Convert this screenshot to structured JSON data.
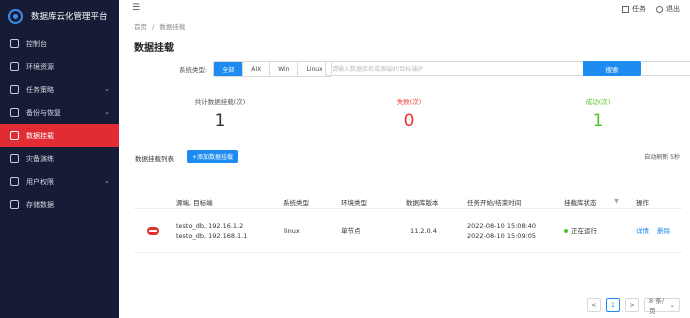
{
  "app": {
    "title": "数据库云化管理平台"
  },
  "sidebar": {
    "items": [
      {
        "label": "控制台",
        "icon": "dashboard-icon"
      },
      {
        "label": "环境资源",
        "icon": "server-icon"
      },
      {
        "label": "任务策略",
        "icon": "task-icon",
        "expand": "⌄"
      },
      {
        "label": "备份与恢复",
        "icon": "backup-icon",
        "expand": "⌄"
      },
      {
        "label": "数据挂载",
        "icon": "mount-icon",
        "active": true
      },
      {
        "label": "灾备演练",
        "icon": "drill-icon"
      },
      {
        "label": "用户权限",
        "icon": "user-icon",
        "expand": "⌄"
      },
      {
        "label": "存储数据",
        "icon": "storage-icon"
      }
    ]
  },
  "header": {
    "menu_glyph": "☰",
    "task_label": "任务",
    "logout_label": "退出"
  },
  "breadcrumb": {
    "home": "首页",
    "sep": "/",
    "current": "数据挂载"
  },
  "page": {
    "title": "数据挂载"
  },
  "filter": {
    "label": "系统类型:",
    "options": [
      "全部",
      "AIX",
      "Win",
      "Linux"
    ],
    "selected": "全部",
    "search_placeholder": "请输入数据库名或源端IP/目标端IP",
    "search_button": "搜索"
  },
  "stats": {
    "total": {
      "label": "共计数据挂载(次)",
      "value": "1"
    },
    "fail": {
      "label": "失败(次)",
      "value": "0"
    },
    "success": {
      "label": "成功(次)",
      "value": "1"
    }
  },
  "section": {
    "title": "数据挂载列表",
    "add_button": "+添加数据挂载",
    "refresh_label": "自动刷新 5秒"
  },
  "table": {
    "headers": [
      "源端, 目标端",
      "系统类型",
      "环境类型",
      "数据库版本",
      "任务开始/结束时间",
      "挂载库状态",
      "操作"
    ],
    "rows": [
      {
        "src": "testo_db, 192.16.1.2",
        "dst": "testo_db, 192.168.1.1",
        "os": "linux",
        "env": "单节点",
        "version": "11.2.0.4",
        "start": "2022-08-10 15:08:40",
        "end": "2022-08-10 15:09:05",
        "status": "正在运行",
        "actions": [
          "详情",
          "删除"
        ]
      }
    ]
  },
  "pagination": {
    "prev": "<",
    "page": "1",
    "next": ">",
    "size": "8 条/页",
    "size_caret": "⌄"
  },
  "colors": {
    "accent": "#1d8bf0",
    "active_nav": "#e12c34",
    "success": "#56c22a",
    "danger": "#ee3333",
    "sidebar_bg": "#171c36"
  }
}
